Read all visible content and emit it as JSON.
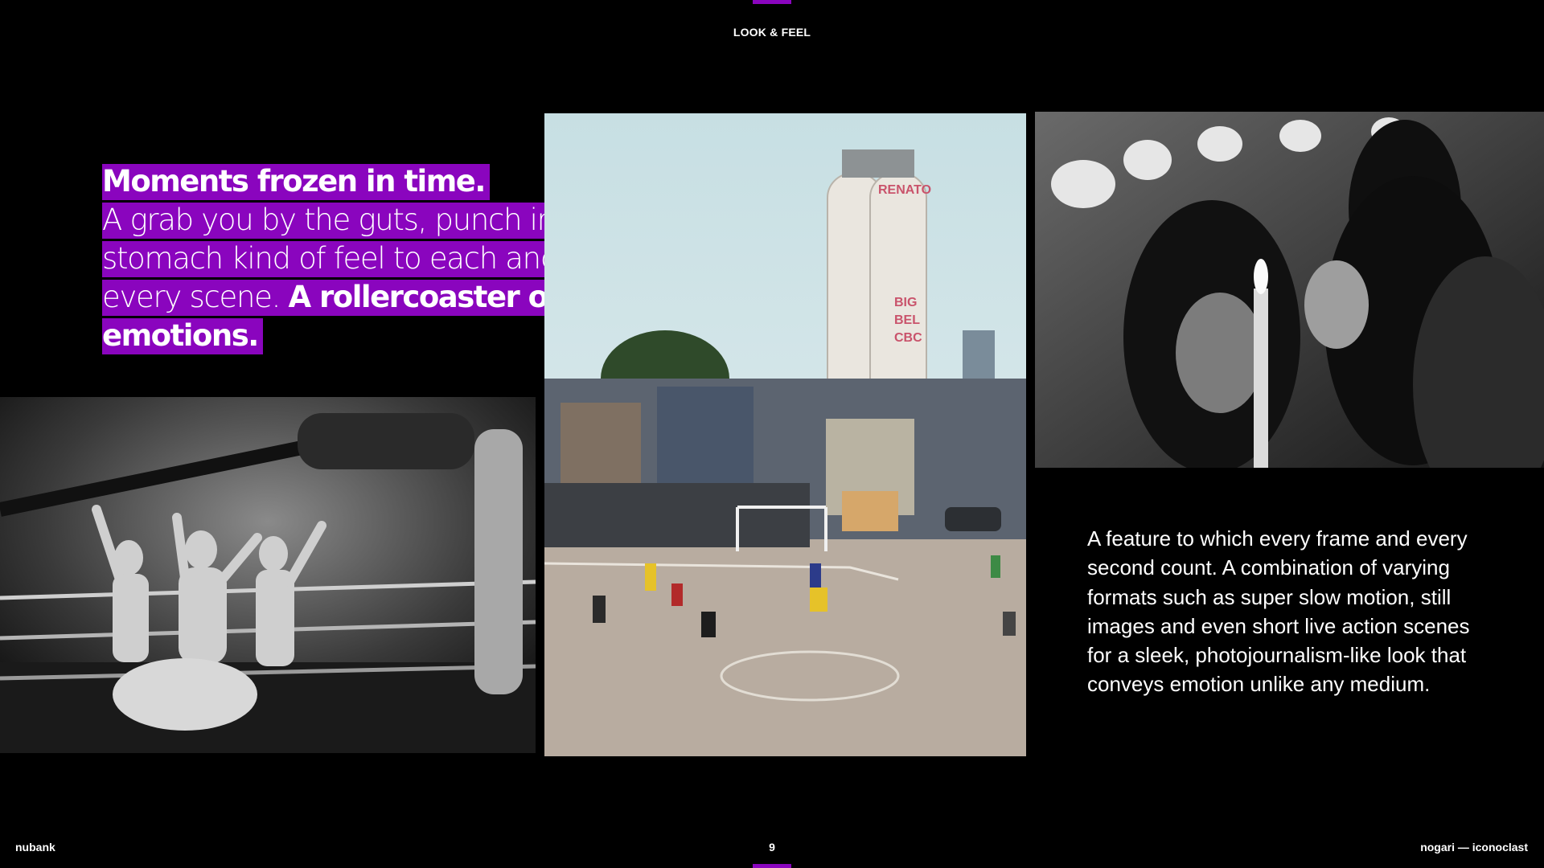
{
  "header": {
    "section_title": "LOOK & FEEL"
  },
  "headline": {
    "line1": "Moments frozen in time.",
    "body": "A grab you by the guts, punch in the stomach kind of feel to each and every scene.",
    "closing": "A rollercoaster of emotions."
  },
  "body_copy": "A feature to which every frame and every second count. A combination of varying formats such as super slow motion, still images and even short live action scenes for a sleek, photojournalism-like look that conveys emotion unlike any medium.",
  "footer": {
    "left": "nubank",
    "page_number": "9",
    "right": "nogari — iconoclast"
  },
  "colors": {
    "accent": "#8a05be",
    "background": "#000000",
    "text": "#ffffff"
  },
  "images": {
    "wrestling": "black-and-white photo of wrestlers raising arms in a boxing ring",
    "football": "kids playing football on a dirt field in front of a graffiti silo tower",
    "candle": "black-and-white photo of people in headscarves holding a candle and flowers"
  }
}
